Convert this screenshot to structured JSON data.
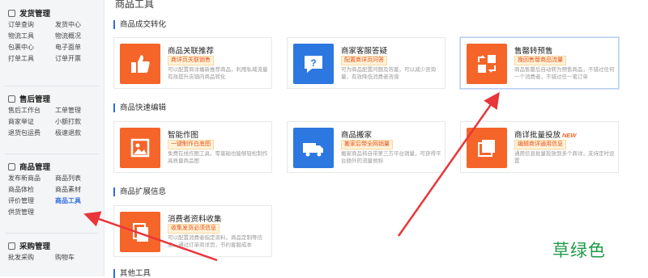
{
  "sidebar": {
    "groups": [
      {
        "title": "发货管理",
        "icon": "truck-icon",
        "rows": [
          [
            "订单查询",
            "发货中心"
          ],
          [
            "物流工具",
            "物流概况"
          ],
          [
            "包裹中心",
            "电子面单"
          ],
          [
            "打单工具",
            "订单开票"
          ]
        ]
      },
      {
        "title": "售后管理",
        "icon": "shield-icon",
        "rows": [
          [
            "售后工作台",
            "工单管理"
          ],
          [
            "商家举证",
            "小额打款"
          ],
          [
            "退货包运费",
            "极速退款"
          ]
        ]
      },
      {
        "title": "商品管理",
        "icon": "box-icon",
        "rows": [
          [
            "发布新商品",
            "商品列表"
          ],
          [
            "商品体检",
            "商品素材"
          ],
          [
            "评价管理",
            "商品工具"
          ],
          [
            "供货管理",
            ""
          ]
        ]
      },
      {
        "title": "采购管理",
        "icon": "cart-icon",
        "rows": [
          [
            "批发采购",
            "购物车"
          ]
        ]
      }
    ],
    "active": "商品工具"
  },
  "main": {
    "page_title": "商品工具",
    "sections": [
      {
        "title": "商品成交转化",
        "cards": [
          {
            "title": "商品关联推荐",
            "tag": "商详页关联销售",
            "desc": "可以配置商详播新推荐商品，利用私域流量有效提升店铺内商品转化",
            "icon": "thumbs-up-icon",
            "color": "orange",
            "new": ""
          },
          {
            "title": "商家客服答疑",
            "tag": "配置商详页问答",
            "desc": "可为商品配置问题及答案，可以减少咨询量，有效降低消费者咨询",
            "icon": "question-chat-icon",
            "color": "blue",
            "new": ""
          },
          {
            "title": "售罄转预售",
            "tag": "挽回售罄商品流量",
            "desc": "商品售罄后自动转为预售商品，不错过任何一个消费者，不错过任一笔订单",
            "icon": "swap-icon",
            "color": "orange",
            "new": ""
          }
        ]
      },
      {
        "title": "商品快速编辑",
        "cards": [
          {
            "title": "智能作图",
            "tag": "一键制作白底图",
            "desc": "免费在线作图工具，零基础也能够轻松制作高质量商品图",
            "icon": "image-icon",
            "color": "orange",
            "new": ""
          },
          {
            "title": "商品搬家",
            "tag": "搬家后带全网销量",
            "desc": "搬家商品将自带第三方平台销量，可获得平台额外的流量倾斜",
            "icon": "truck-move-icon",
            "color": "blue",
            "new": ""
          },
          {
            "title": "商详批量投放",
            "tag": "编辑商详通用信息",
            "desc": "通用信息批量投放到多个商详，支持定时设置",
            "icon": "stack-icon",
            "color": "orange",
            "new": "NEW"
          }
        ]
      },
      {
        "title": "商品扩展信息",
        "cards": [
          {
            "title": "消费者资料收集",
            "tag": "收集发货必须信息",
            "desc": "可以配置消费者指定资料，商品定制等信息，通过订单商详页，节约客服成本",
            "icon": "form-icon",
            "color": "orange",
            "new": ""
          }
        ]
      },
      {
        "title": "其他工具",
        "cards": []
      }
    ]
  },
  "watermark": "草绿色",
  "colors": {
    "accent": "#2d6cdf",
    "orange": "#f5652a",
    "blue": "#2d77e0",
    "arrow": "#e8363a",
    "watermark": "#1e9a47"
  }
}
